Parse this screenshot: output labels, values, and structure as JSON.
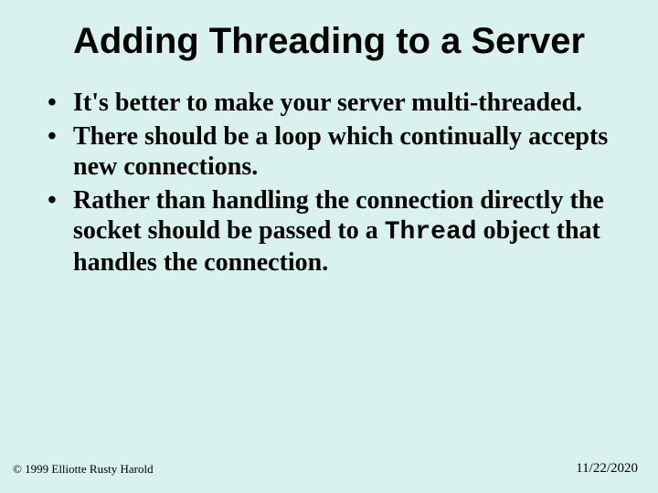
{
  "title": "Adding Threading to a Server",
  "bullets": [
    {
      "pre": "It's better to make your server multi-threaded.",
      "code": "",
      "post": ""
    },
    {
      "pre": "There should be a loop which continually accepts new connections.",
      "code": "",
      "post": ""
    },
    {
      "pre": "Rather than handling the connection directly the socket should be passed to a ",
      "code": "Thread",
      "post": " object that handles the connection."
    }
  ],
  "footer": {
    "copyright": "© 1999 Elliotte Rusty Harold",
    "date": "11/22/2020"
  }
}
